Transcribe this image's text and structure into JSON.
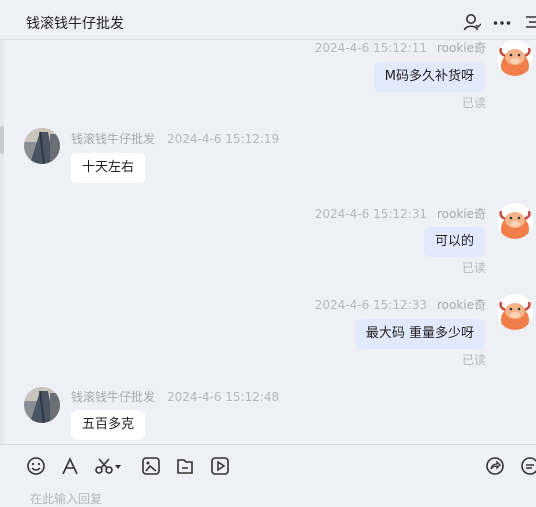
{
  "header": {
    "title": "钱滚钱牛仔批发"
  },
  "messages": [
    {
      "side": "me",
      "time": "2024-4-6 15:12:11",
      "sender": "rookie奇",
      "text": "M码多久补货呀",
      "status": "已读"
    },
    {
      "side": "them",
      "time": "2024-4-6 15:12:19",
      "sender": "钱滚钱牛仔批发",
      "text": "十天左右"
    },
    {
      "side": "me",
      "time": "2024-4-6 15:12:31",
      "sender": "rookie奇",
      "text": "可以的",
      "status": "已读"
    },
    {
      "side": "me",
      "time": "2024-4-6 15:12:33",
      "sender": "rookie奇",
      "text": "最大码 重量多少呀",
      "status": "已读"
    },
    {
      "side": "them",
      "time": "2024-4-6 15:12:48",
      "sender": "钱滚钱牛仔批发",
      "text": "五百多克"
    }
  ],
  "input": {
    "placeholder": "在此输入回复"
  },
  "colors": {
    "my_bubble": "#e2e9fb",
    "their_bubble": "#ffffff",
    "background": "#eff0f5",
    "avatar_orange": "#f07d4a"
  }
}
